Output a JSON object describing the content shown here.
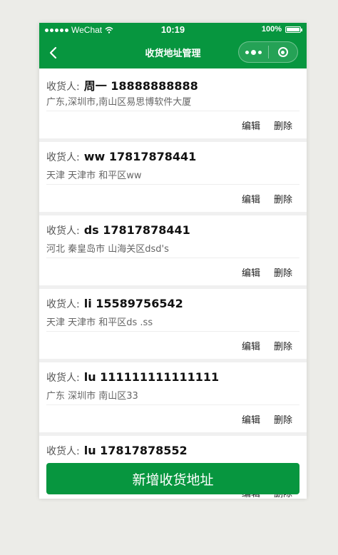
{
  "status_bar": {
    "carrier": "WeChat",
    "time": "10:19",
    "battery": "100%"
  },
  "nav": {
    "title": "收货地址管理"
  },
  "addresses": [
    {
      "label": "收货人:",
      "name_phone": "周一 18888888888",
      "address": "广东,深圳市,南山区易思博软件大厦",
      "edit": "编辑",
      "delete": "删除"
    },
    {
      "label": "收货人:",
      "name_phone": "ww 17817878441",
      "address": "天津 天津市 和平区ww",
      "edit": "编辑",
      "delete": "删除"
    },
    {
      "label": "收货人:",
      "name_phone": "ds 17817878441",
      "address": "河北 秦皇岛市 山海关区dsd's",
      "edit": "编辑",
      "delete": "删除"
    },
    {
      "label": "收货人:",
      "name_phone": "li 15589756542",
      "address": "天津 天津市 和平区ds .ss",
      "edit": "编辑",
      "delete": "删除"
    },
    {
      "label": "收货人:",
      "name_phone": "lu 111111111111111",
      "address": "广东 深圳市 南山区33",
      "edit": "编辑",
      "delete": "删除"
    },
    {
      "label": "收货人:",
      "name_phone": "lu 17817878552",
      "address": "",
      "edit": "编辑",
      "delete": "删除"
    }
  ],
  "add_button": "新增收货地址",
  "colors": {
    "brand": "#07963f",
    "background": "#f0f0f0"
  },
  "icons": {
    "back": "chevron-left-icon",
    "more": "more-dots-icon",
    "close": "target-icon"
  }
}
